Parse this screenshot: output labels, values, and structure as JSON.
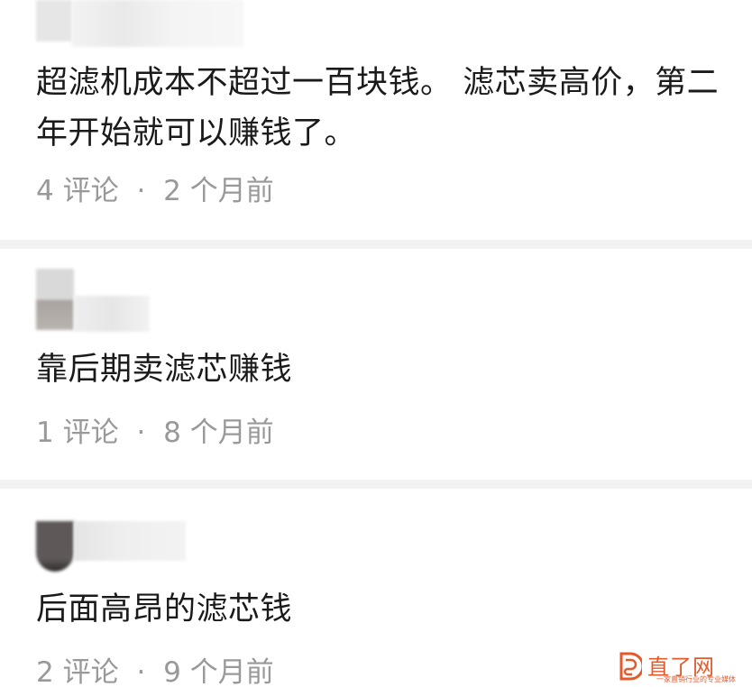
{
  "comments": [
    {
      "text": "超滤机成本不超过一百块钱。 滤芯卖高价，第二年开始就可以赚钱了。",
      "reply_count": "4",
      "reply_label": "评论",
      "time": "2 个月前"
    },
    {
      "text": "靠后期卖滤芯赚钱",
      "reply_count": "1",
      "reply_label": "评论",
      "time": "8 个月前"
    },
    {
      "text": "后面高昂的滤芯钱",
      "reply_count": "2",
      "reply_label": "评论",
      "time": "9 个月前"
    }
  ],
  "separator": "·",
  "watermark": {
    "title": "直了网",
    "subtitle": "一家直销行业的专业媒体"
  },
  "colors": {
    "text": "#1a1a1a",
    "meta": "#999999",
    "separator_band": "#f2f2f2",
    "watermark": "#e55a2b"
  }
}
